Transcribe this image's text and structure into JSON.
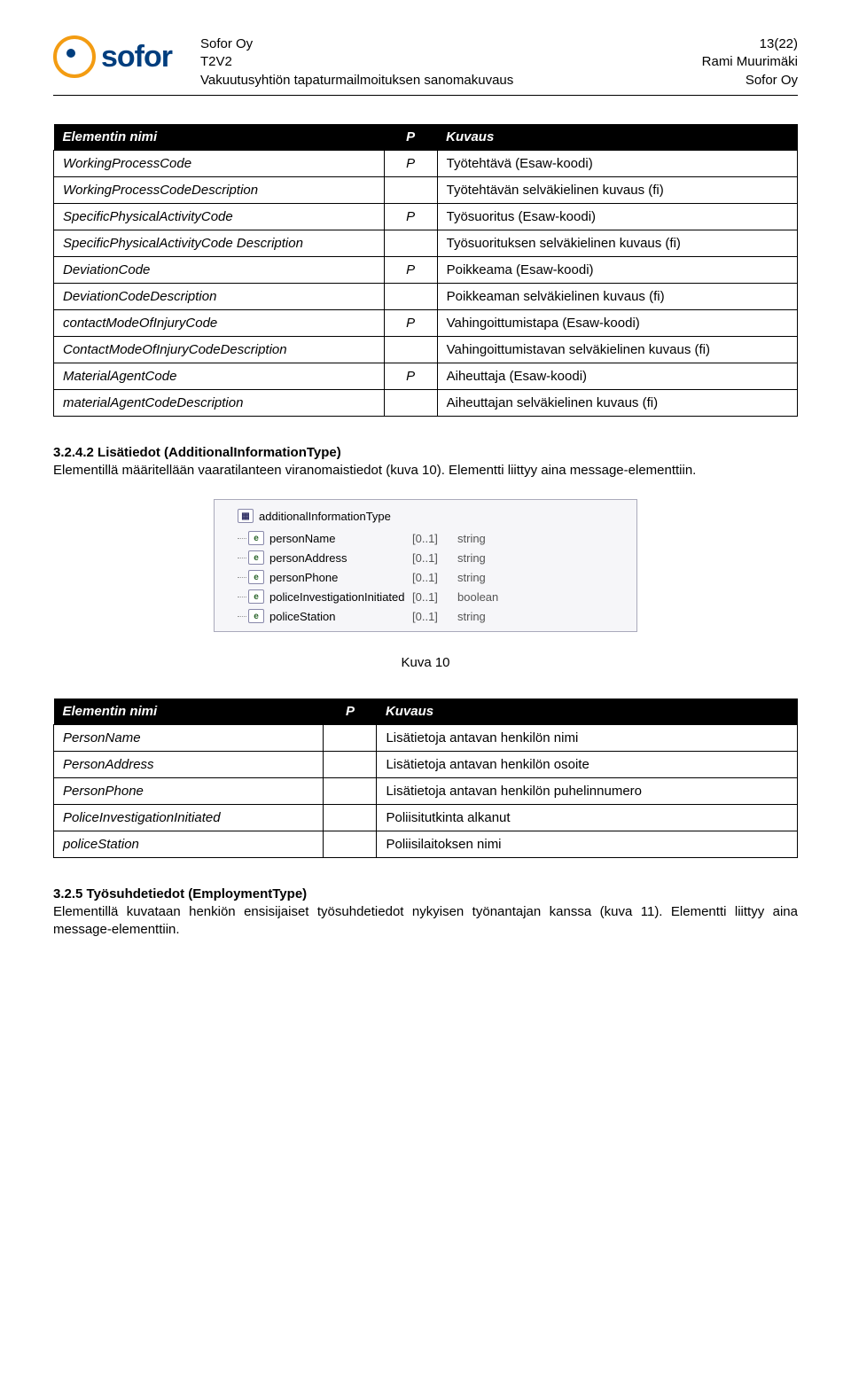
{
  "logo_text": "sofor",
  "header": {
    "left1": "Sofor Oy",
    "left2": "T2V2",
    "left3": "Vakuutusyhtiön tapaturmailmoituksen sanomakuvaus",
    "right1": "13(22)",
    "right2": "Rami Muurimäki",
    "right3": "Sofor Oy"
  },
  "table1": {
    "headers": {
      "name": "Elementin nimi",
      "p": "P",
      "desc": "Kuvaus"
    },
    "rows": [
      {
        "name": "WorkingProcessCode",
        "p": "P",
        "desc": "Työtehtävä (Esaw-koodi)"
      },
      {
        "name": "WorkingProcessCodeDescription",
        "p": "",
        "desc": "Työtehtävän selväkielinen kuvaus (fi)"
      },
      {
        "name": "SpecificPhysicalActivityCode",
        "p": "P",
        "desc": "Työsuoritus (Esaw-koodi)"
      },
      {
        "name": "SpecificPhysicalActivityCode Description",
        "p": "",
        "desc": "Työsuorituksen selväkielinen kuvaus (fi)"
      },
      {
        "name": "DeviationCode",
        "p": "P",
        "desc": "Poikkeama (Esaw-koodi)"
      },
      {
        "name": "DeviationCodeDescription",
        "p": "",
        "desc": "Poikkeaman selväkielinen kuvaus (fi)"
      },
      {
        "name": "contactModeOfInjuryCode",
        "p": "P",
        "desc": "Vahingoittumistapa (Esaw-koodi)"
      },
      {
        "name": "ContactModeOfInjuryCodeDescription",
        "p": "",
        "desc": "Vahingoittumistavan selväkielinen kuvaus (fi)"
      },
      {
        "name": "MaterialAgentCode",
        "p": "P",
        "desc": "Aiheuttaja (Esaw-koodi)"
      },
      {
        "name": "materialAgentCodeDescription",
        "p": "",
        "desc": "Aiheuttajan selväkielinen kuvaus (fi)"
      }
    ]
  },
  "section342": {
    "title": "3.2.4.2  Lisätiedot (AdditionalInformationType)",
    "body": "Elementillä määritellään vaaratilanteen viranomaistiedot (kuva 10).  Elementti liittyy aina  message-elementtiin."
  },
  "tree": {
    "root": "additionalInformationType",
    "children": [
      {
        "label": "personName",
        "card": "[0..1]",
        "type": "string"
      },
      {
        "label": "personAddress",
        "card": "[0..1]",
        "type": "string"
      },
      {
        "label": "personPhone",
        "card": "[0..1]",
        "type": "string"
      },
      {
        "label": "policeInvestigationInitiated",
        "card": "[0..1]",
        "type": "boolean"
      },
      {
        "label": "policeStation",
        "card": "[0..1]",
        "type": "string"
      }
    ]
  },
  "caption10": "Kuva 10",
  "table2": {
    "headers": {
      "name": "Elementin nimi",
      "p": "P",
      "desc": "Kuvaus"
    },
    "rows": [
      {
        "name": "PersonName",
        "p": "",
        "desc": "Lisätietoja antavan henkilön nimi"
      },
      {
        "name": "PersonAddress",
        "p": "",
        "desc": "Lisätietoja antavan henkilön osoite"
      },
      {
        "name": "PersonPhone",
        "p": "",
        "desc": "Lisätietoja antavan henkilön puhelinnumero"
      },
      {
        "name": "PoliceInvestigationInitiated",
        "p": "",
        "desc": "Poliisitutkinta alkanut"
      },
      {
        "name": "policeStation",
        "p": "",
        "desc": "Poliisilaitoksen nimi"
      }
    ]
  },
  "section325": {
    "title": "3.2.5  Työsuhdetiedot (EmploymentType)",
    "body": "Elementillä kuvataan henkiön ensisijaiset työsuhdetiedot nykyisen työnantajan kanssa (kuva 11). Elementti liittyy aina  message-elementtiin."
  }
}
